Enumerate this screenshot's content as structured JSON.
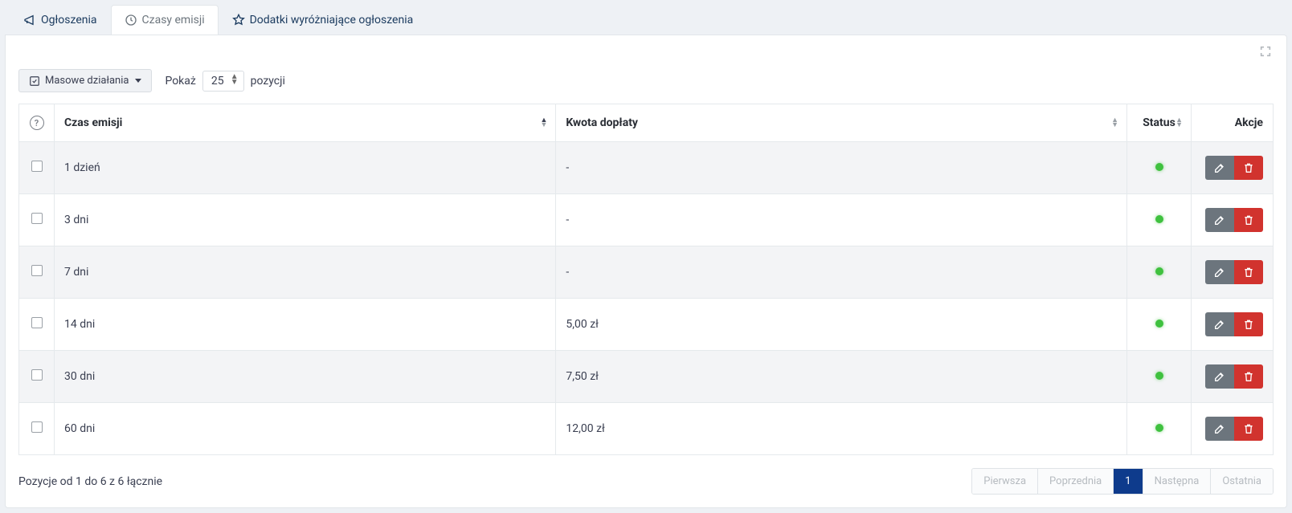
{
  "tabs": [
    {
      "label": "Ogłoszenia",
      "icon": "megaphone-icon",
      "active": false
    },
    {
      "label": "Czasy emisji",
      "icon": "clock-icon",
      "active": true
    },
    {
      "label": "Dodatki wyróżniające ogłoszenia",
      "icon": "star-icon",
      "active": false
    }
  ],
  "toolbar": {
    "bulk_label": "Masowe działania",
    "show_label": "Pokaż",
    "show_value": "25",
    "positions_label": "pozycji"
  },
  "columns": {
    "help": "?",
    "emission": "Czas emisji",
    "surcharge": "Kwota dopłaty",
    "status": "Status",
    "actions": "Akcje"
  },
  "rows": [
    {
      "emission": "1 dzień",
      "surcharge": "-",
      "status": "active"
    },
    {
      "emission": "3 dni",
      "surcharge": "-",
      "status": "active"
    },
    {
      "emission": "7 dni",
      "surcharge": "-",
      "status": "active"
    },
    {
      "emission": "14 dni",
      "surcharge": "5,00 zł",
      "status": "active"
    },
    {
      "emission": "30 dni",
      "surcharge": "7,50 zł",
      "status": "active"
    },
    {
      "emission": "60 dni",
      "surcharge": "12,00 zł",
      "status": "active"
    }
  ],
  "footer": {
    "summary": "Pozycje od 1 do 6 z 6 łącznie",
    "pagination": {
      "first": "Pierwsza",
      "prev": "Poprzednia",
      "current": "1",
      "next": "Następna",
      "last": "Ostatnia"
    }
  }
}
